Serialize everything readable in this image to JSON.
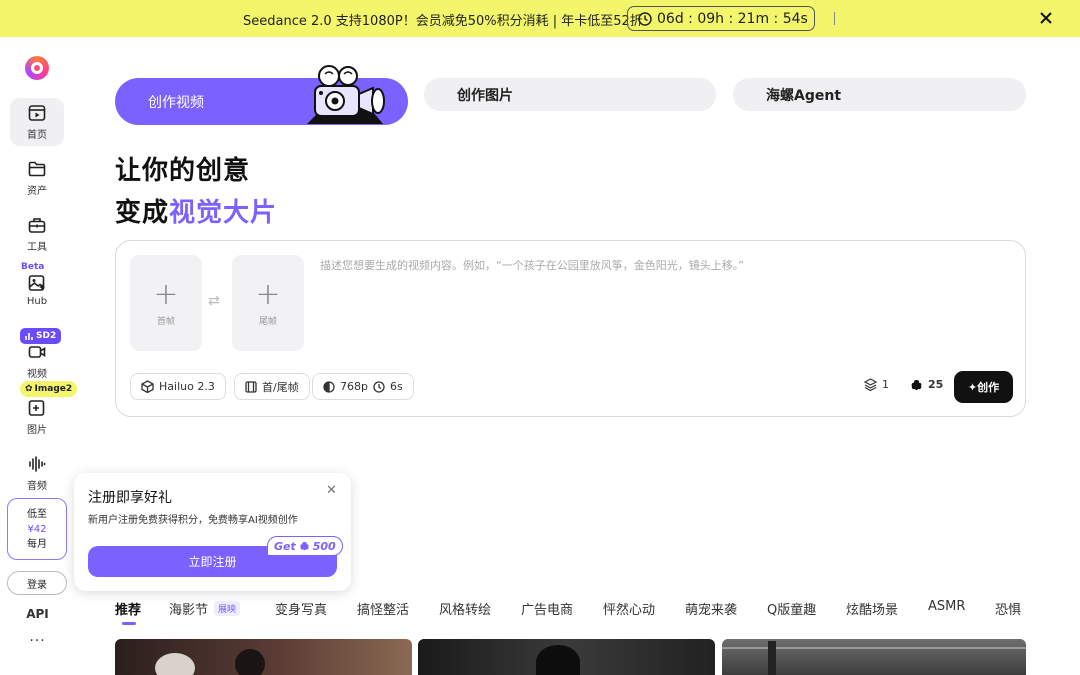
{
  "promo": {
    "text": "Seedance 2.0 支持1080P！会员减免50%积分消耗 | 年卡低至52折",
    "countdown": "06d : 09h : 21m : 54s",
    "close_icon": "close-icon",
    "bg_color": "#f3f56a"
  },
  "sidebar": {
    "items": [
      {
        "label": "首页",
        "icon": "play-square-icon",
        "active": true
      },
      {
        "label": "资产",
        "icon": "folder-icon"
      },
      {
        "label": "工具",
        "icon": "toolbox-icon"
      },
      {
        "label": "Hub",
        "icon": "image-sparkle-icon"
      },
      {
        "label": "视频",
        "icon": "video-icon"
      },
      {
        "label": "图片",
        "icon": "image-plus-icon"
      },
      {
        "label": "音频",
        "icon": "audio-wave-icon"
      }
    ],
    "badge_beta": "Beta",
    "badge_sd2": "SD2",
    "badge_image2": "Image2",
    "price": {
      "line1": "低至",
      "line2": "¥42",
      "line3": "每月"
    },
    "login": "登录",
    "api": "API",
    "more": "···"
  },
  "tabs": {
    "video": "创作视频",
    "image": "创作图片",
    "agent": "海螺Agent"
  },
  "headline": {
    "line1": "让你的创意",
    "line2_prefix": "变成",
    "line2_highlight": "视觉大片",
    "accent_color": "#7b61ff"
  },
  "composer": {
    "first_frame": "首帧",
    "last_frame": "尾帧",
    "prompt_placeholder": "描述您想要生成的视频内容。例如，“一个孩子在公园里放风筝，金色阳光，镜头上移。”",
    "model": "Hailuo 2.3",
    "frame_mode": "首/尾帧",
    "resolution": "768p",
    "duration": "6s",
    "quantity": "1",
    "credits": "25",
    "create": "创作"
  },
  "popup": {
    "title": "注册即享好礼",
    "desc": "新用户注册免费获得积分，免费畅享AI视频创作",
    "button": "立即注册",
    "badge_prefix": "Get",
    "badge_amount": "500"
  },
  "categories": [
    {
      "label": "推荐",
      "active": true
    },
    {
      "label": "海影节",
      "tag": "展映"
    },
    {
      "label": "变身写真"
    },
    {
      "label": "搞怪整活"
    },
    {
      "label": "风格转绘"
    },
    {
      "label": "广告电商"
    },
    {
      "label": "怦然心动"
    },
    {
      "label": "萌宠来袭"
    },
    {
      "label": "Q版童趣"
    },
    {
      "label": "炫酷场景"
    },
    {
      "label": "ASMR"
    },
    {
      "label": "恐惧"
    }
  ]
}
